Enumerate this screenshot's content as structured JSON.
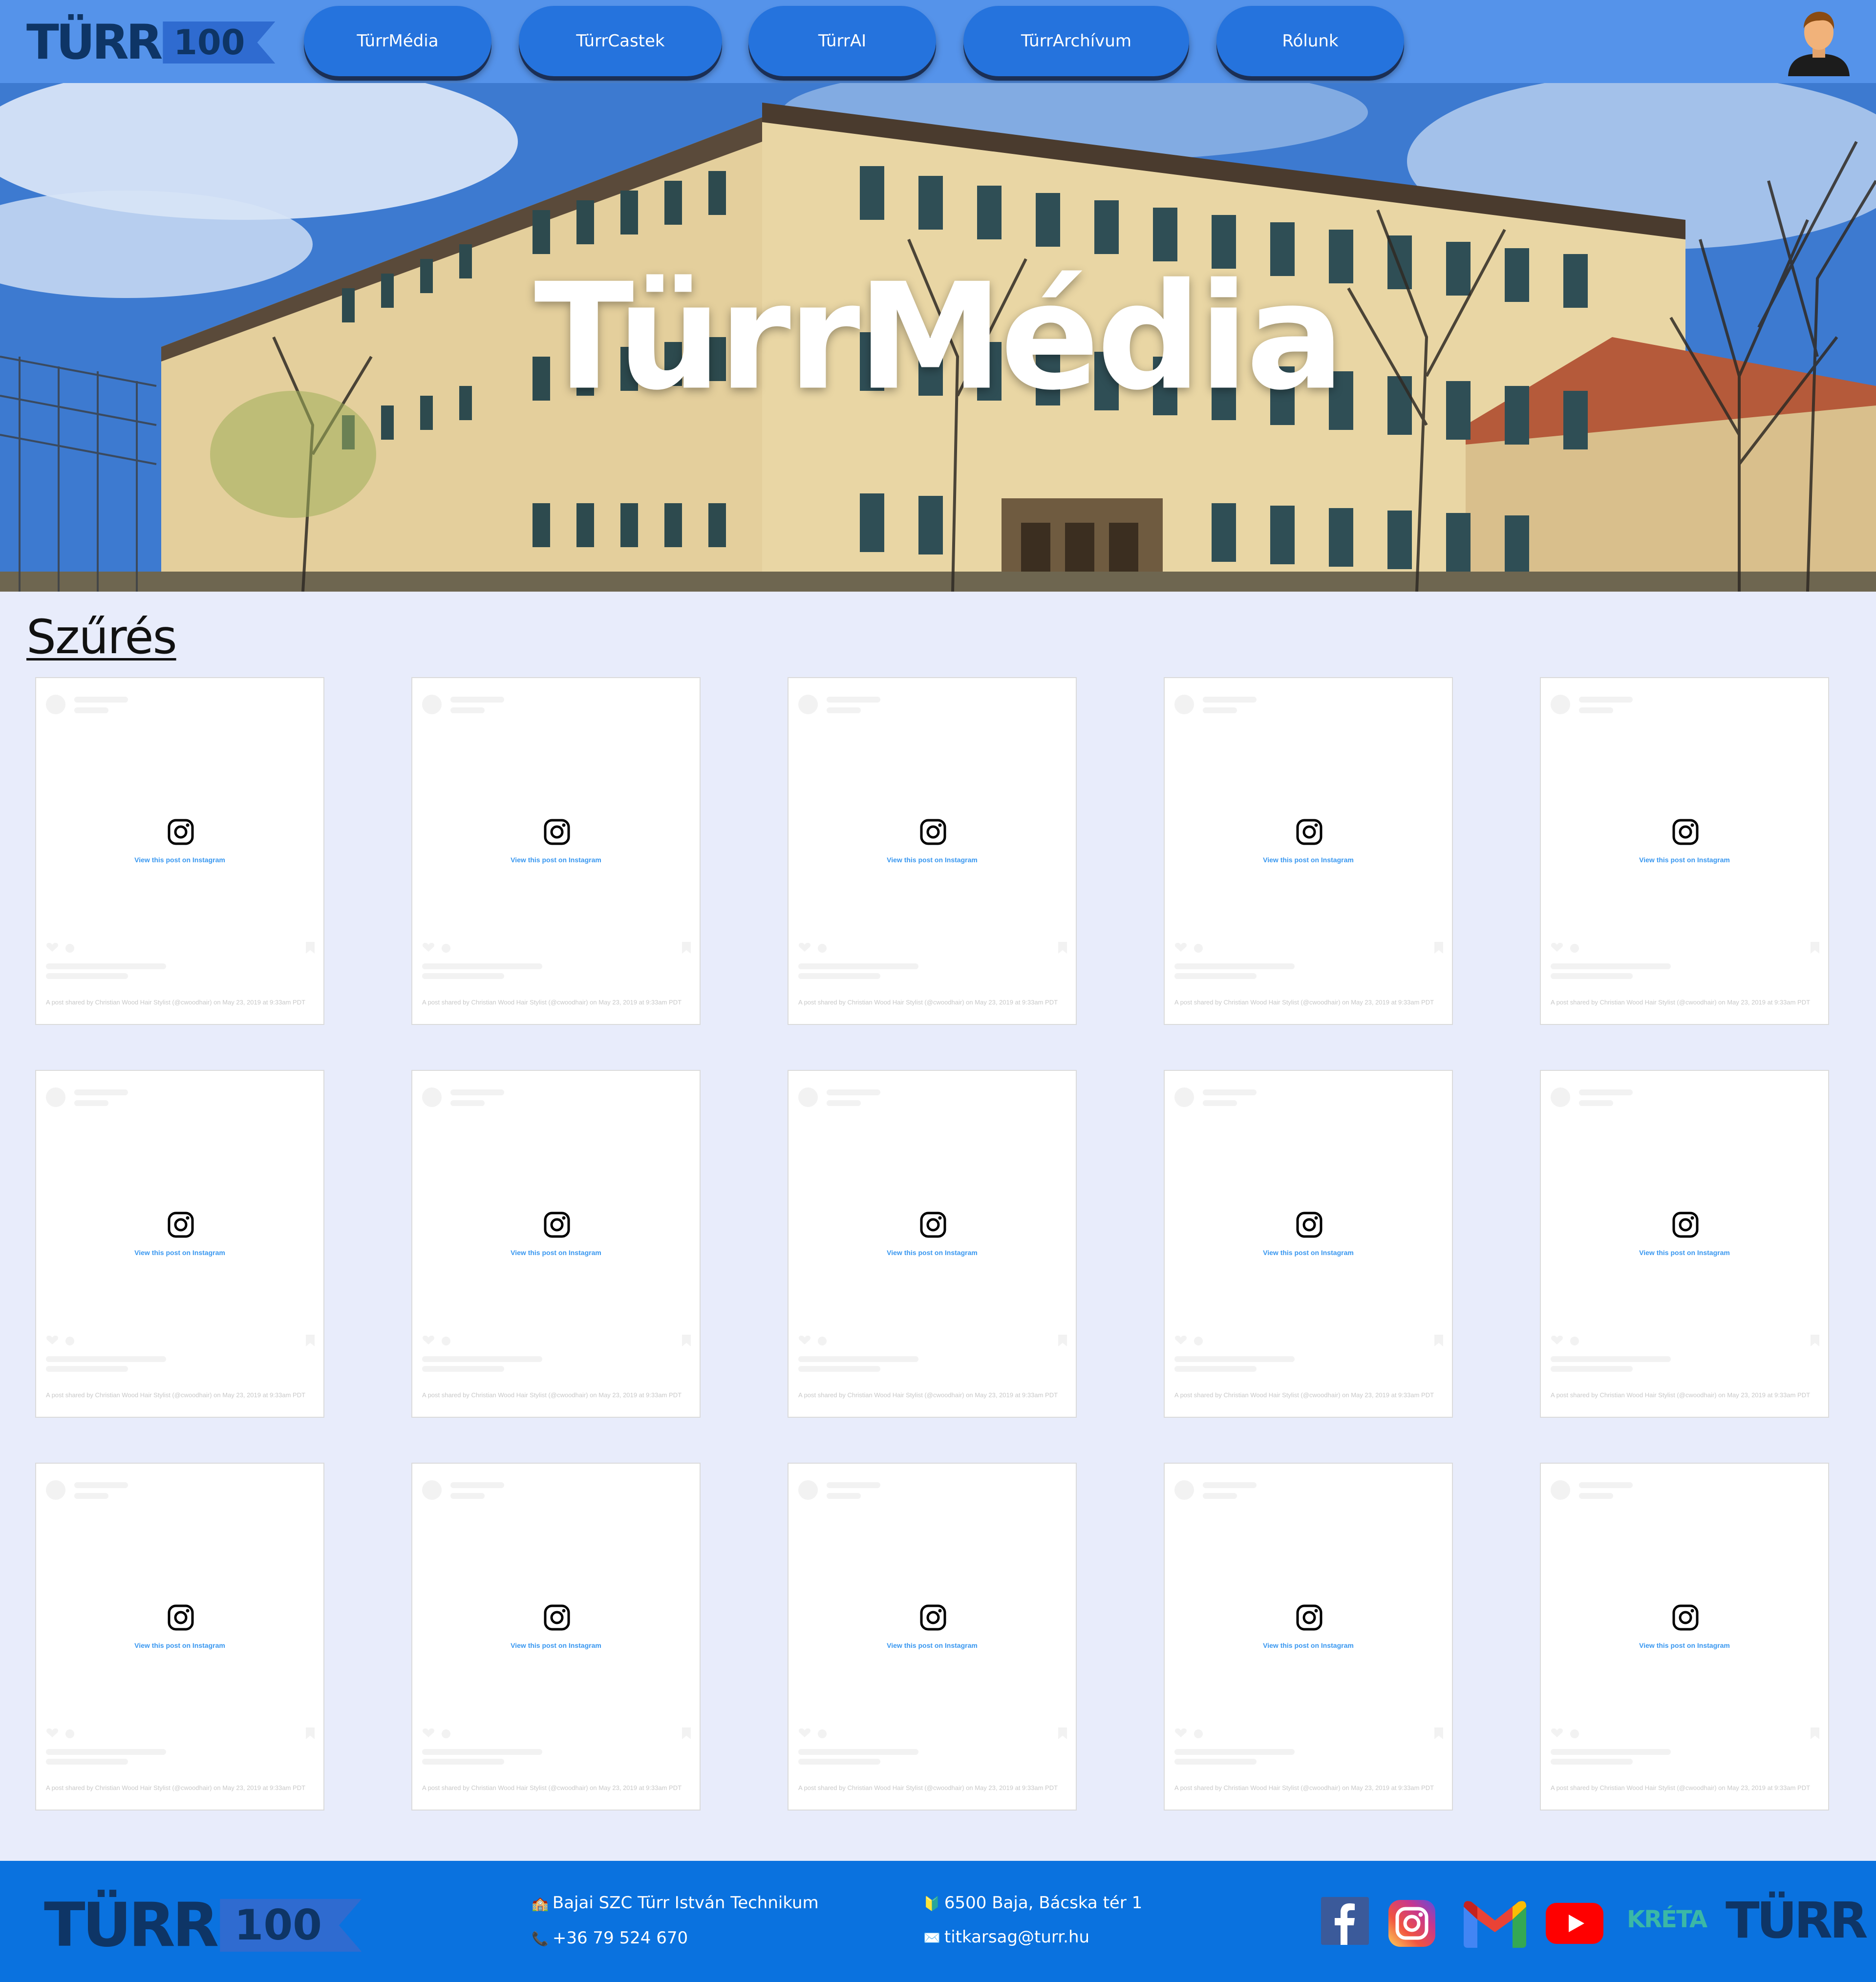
{
  "header": {
    "logo": {
      "word": "TÜRR",
      "number": "100"
    },
    "nav": [
      "TürrMédia",
      "TürrCastek",
      "TürrAI",
      "TürrArchívum",
      "Rólunk"
    ]
  },
  "hero": {
    "title": "TürrMédia"
  },
  "filter": {
    "label": "Szűrés"
  },
  "posts": {
    "link_text": "View this post on Instagram",
    "caption": "A post shared by Christian Wood Hair Stylist (@cwoodhair) on May 23, 2019 at 9:33am PDT",
    "count": 15
  },
  "footer": {
    "logo": {
      "word": "TÜRR",
      "number": "100"
    },
    "school": "Bajai SZC Türr István Technikum",
    "phone": "+36 79 524 670",
    "address": "6500 Baja, Bácska tér 1",
    "email": "titkarsag@turr.hu",
    "socials": [
      "facebook-icon",
      "instagram-icon",
      "gmail-icon",
      "youtube-icon",
      "kreta-logo",
      "turr-logo"
    ],
    "kreta_label": "KRÉTA",
    "turr_label": "TÜRR"
  },
  "colors": {
    "header_bg": "#5593ea",
    "nav_button": "#2573dd",
    "page_bg": "#e8ecfb",
    "footer_bg": "#0a72df",
    "logo_dark": "#0e3566",
    "instagram_link": "#3897f0"
  }
}
